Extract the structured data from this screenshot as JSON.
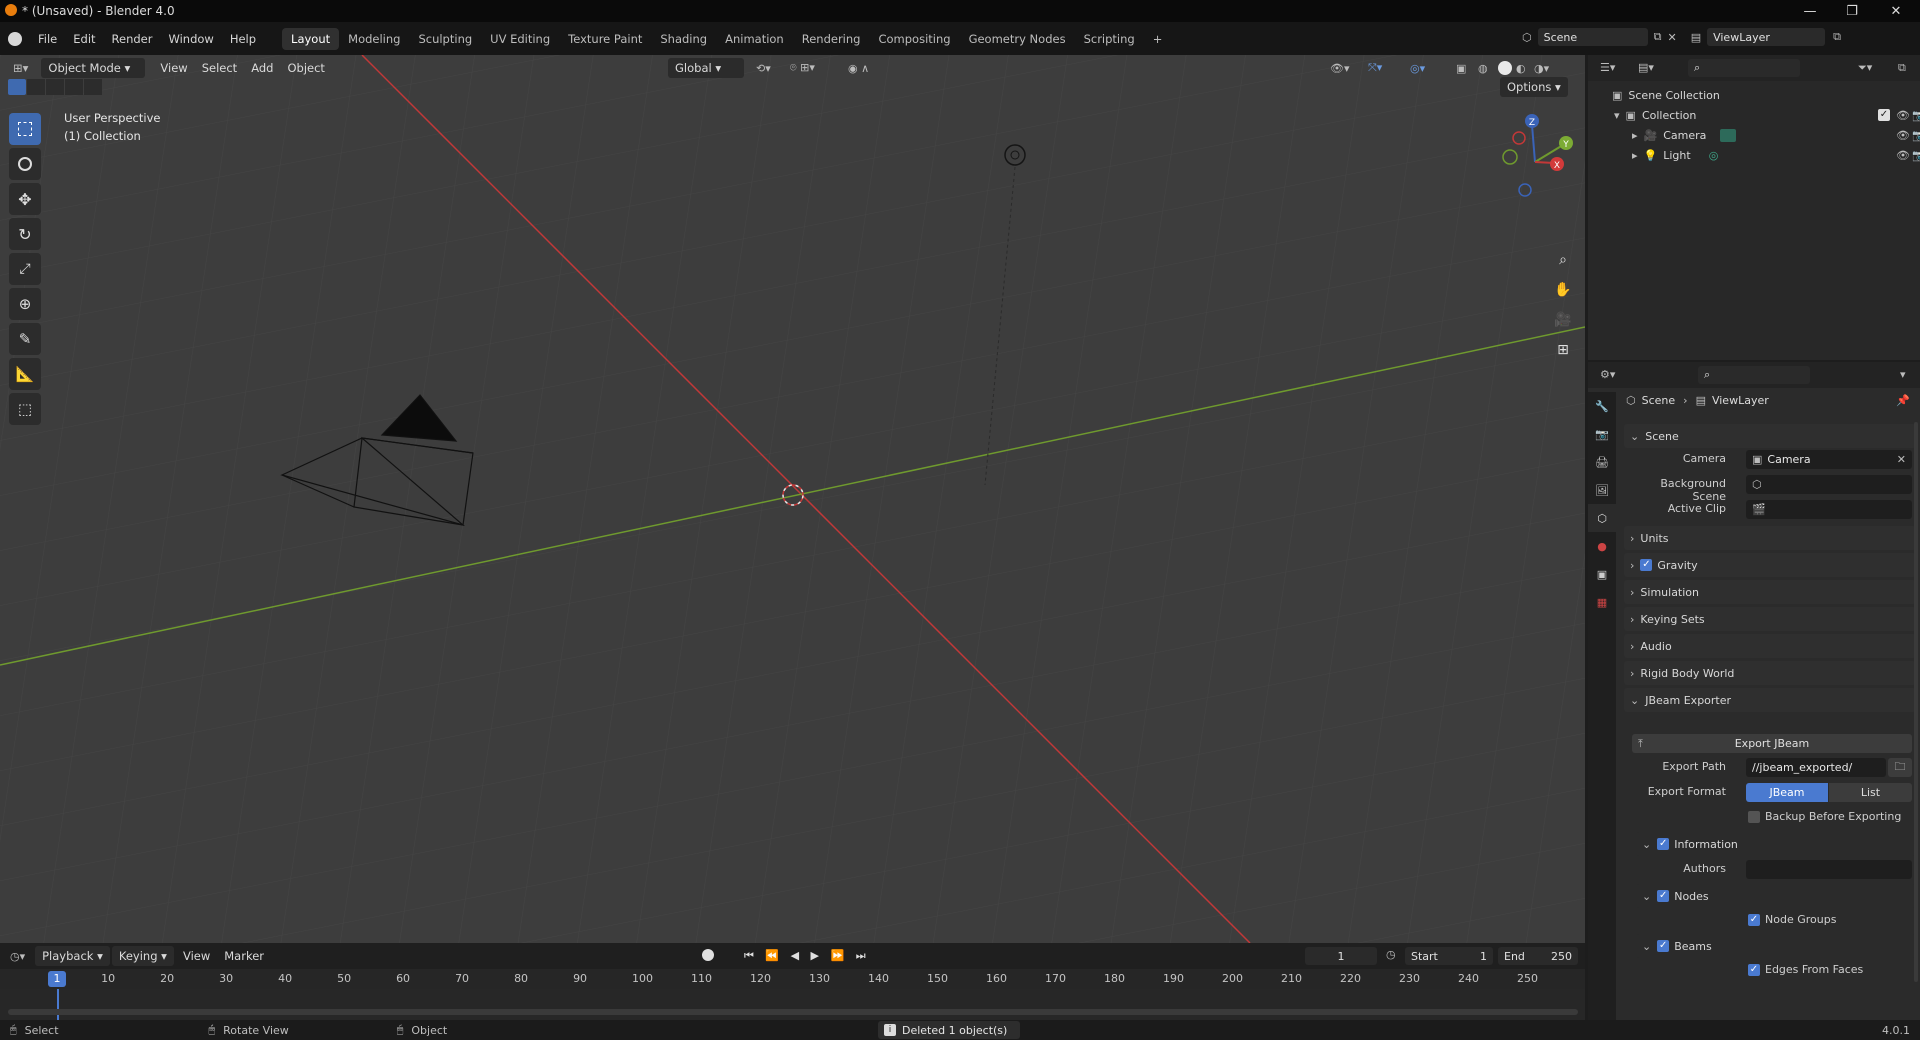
{
  "window": {
    "title": "* (Unsaved) - Blender 4.0",
    "minimize": "—",
    "restore": "❐",
    "close": "✕"
  },
  "menu": [
    "File",
    "Edit",
    "Render",
    "Window",
    "Help"
  ],
  "workspaces": [
    "Layout",
    "Modeling",
    "Sculpting",
    "UV Editing",
    "Texture Paint",
    "Shading",
    "Animation",
    "Rendering",
    "Compositing",
    "Geometry Nodes",
    "Scripting",
    "+"
  ],
  "active_workspace": "Layout",
  "scene_selector": {
    "scene": "Scene",
    "view_layer": "ViewLayer"
  },
  "viewport": {
    "mode": "Object Mode",
    "menus": [
      "View",
      "Select",
      "Add",
      "Object"
    ],
    "transform": "Global",
    "options": "Options",
    "overlay_title": "User Perspective",
    "overlay_sub": "(1) Collection",
    "axes": {
      "z": "Z",
      "y": "Y",
      "x": "X"
    },
    "tools": [
      "select-box-icon",
      "cursor-icon",
      "move-icon",
      "rotate-icon",
      "scale-icon",
      "transform-icon",
      "annotate-icon",
      "measure-icon",
      "add-cube-icon"
    ]
  },
  "timeline": {
    "menus": [
      "Playback",
      "Keying",
      "View",
      "Marker"
    ],
    "current_frame": "1",
    "start_label": "Start",
    "start": "1",
    "end_label": "End",
    "end": "250",
    "ticks": [
      "1",
      "10",
      "20",
      "30",
      "40",
      "50",
      "60",
      "70",
      "80",
      "90",
      "100",
      "110",
      "120",
      "130",
      "140",
      "150",
      "160",
      "170",
      "180",
      "190",
      "200",
      "210",
      "220",
      "230",
      "240",
      "250"
    ]
  },
  "statusbar": {
    "select": "Select",
    "rotate": "Rotate View",
    "object": "Object",
    "message": "Deleted 1 object(s)",
    "version": "4.0.1"
  },
  "outliner": {
    "root": "Scene Collection",
    "collection": "Collection",
    "items": [
      "Camera",
      "Light"
    ]
  },
  "properties": {
    "breadcrumb": {
      "scene": "Scene",
      "view_layer": "ViewLayer"
    },
    "scene_section": "Scene",
    "fields": {
      "camera_label": "Camera",
      "camera_value": "Camera",
      "bg_label": "Background Scene",
      "clip_label": "Active Clip"
    },
    "sections": [
      "Units",
      "Gravity",
      "Simulation",
      "Keying Sets",
      "Audio",
      "Rigid Body World",
      "JBeam Exporter"
    ],
    "jbeam": {
      "export_button": "Export JBeam",
      "path_label": "Export Path",
      "path_value": "//jbeam_exported/",
      "format_label": "Export Format",
      "format_options": [
        "JBeam",
        "List"
      ],
      "backup": "Backup Before Exporting",
      "information": "Information",
      "authors": "Authors",
      "nodes": "Nodes",
      "node_groups": "Node Groups",
      "beams": "Beams",
      "edges_from_faces": "Edges From Faces"
    }
  },
  "colors": {
    "accent": "#4a7ad0",
    "x_axis": "#c23838",
    "y_axis": "#6f9a2e"
  }
}
